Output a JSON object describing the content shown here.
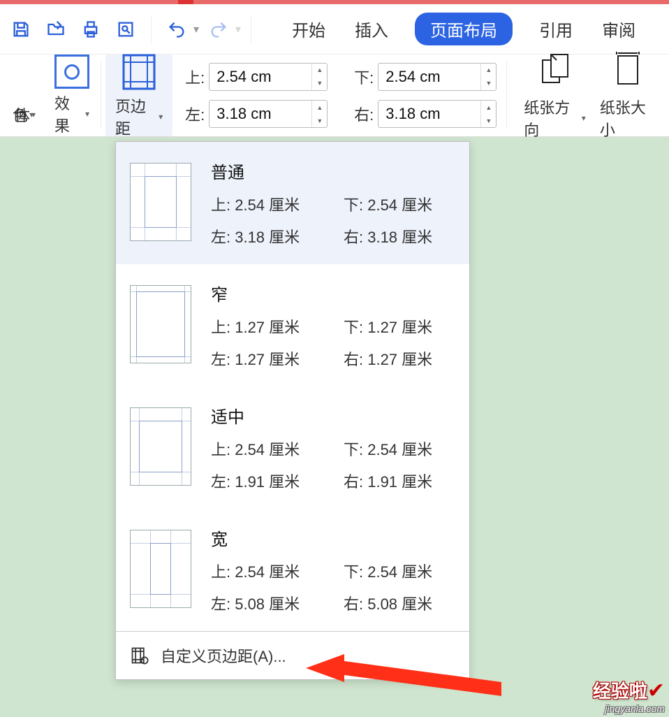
{
  "tabs": {
    "start": "开始",
    "insert": "插入",
    "layout": "页面布局",
    "ref": "引用",
    "review": "审阅"
  },
  "ribbon": {
    "color_label": "色",
    "font_label": "体",
    "effect_label": "效果",
    "margin_label": "页边距",
    "top_lbl": "上:",
    "bottom_lbl": "下:",
    "left_lbl": "左:",
    "right_lbl": "右:",
    "top_val": "2.54 cm",
    "bottom_val": "2.54 cm",
    "left_val": "3.18 cm",
    "right_val": "3.18 cm",
    "orient_label": "纸张方向",
    "size_label": "纸张大小"
  },
  "presets": [
    {
      "name": "普通",
      "top": "上: 2.54 厘米",
      "bottom": "下: 2.54 厘米",
      "left": "左: 3.18 厘米",
      "right": "右: 3.18 厘米",
      "thumb": {
        "t": 18,
        "b": 18,
        "l": 20,
        "r": 20
      }
    },
    {
      "name": "窄",
      "top": "上: 1.27 厘米",
      "bottom": "下: 1.27 厘米",
      "left": "左: 1.27 厘米",
      "right": "右: 1.27 厘米",
      "thumb": {
        "t": 8,
        "b": 8,
        "l": 8,
        "r": 8
      }
    },
    {
      "name": "适中",
      "top": "上: 2.54 厘米",
      "bottom": "下: 2.54 厘米",
      "left": "左: 1.91 厘米",
      "right": "右: 1.91 厘米",
      "thumb": {
        "t": 18,
        "b": 18,
        "l": 12,
        "r": 12
      }
    },
    {
      "name": "宽",
      "top": "上: 2.54 厘米",
      "bottom": "下: 2.54 厘米",
      "left": "左: 5.08 厘米",
      "right": "右: 5.08 厘米",
      "thumb": {
        "t": 18,
        "b": 18,
        "l": 28,
        "r": 28
      }
    }
  ],
  "custom_margin": "自定义页边距(A)...",
  "watermark": {
    "main": "经验啦",
    "site": "jingyanla.com"
  }
}
